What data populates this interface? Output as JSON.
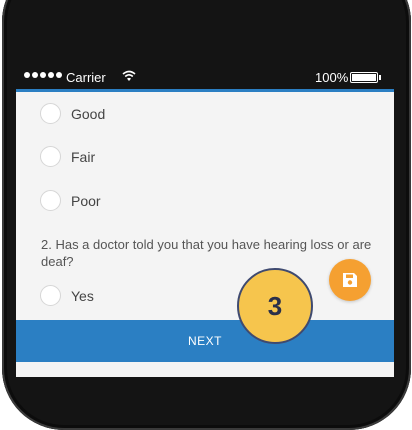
{
  "status_bar": {
    "carrier": "Carrier",
    "battery": "100%",
    "signal_icon": "signal-dots-icon",
    "wifi_icon": "wifi-icon",
    "battery_icon": "battery-icon"
  },
  "colors": {
    "primary": "#2b7fc3",
    "fab": "#f5a031",
    "badge": "#f6c54d"
  },
  "options_q1": [
    {
      "label": "Good"
    },
    {
      "label": "Fair"
    },
    {
      "label": "Poor"
    }
  ],
  "question2": {
    "text": "2. Has a doctor told you that you have hearing loss or are deaf?",
    "options": [
      {
        "label": "Yes"
      }
    ]
  },
  "next_button": {
    "label": "NEXT"
  },
  "fab": {
    "icon": "save-icon"
  },
  "step_badge": {
    "value": "3"
  }
}
